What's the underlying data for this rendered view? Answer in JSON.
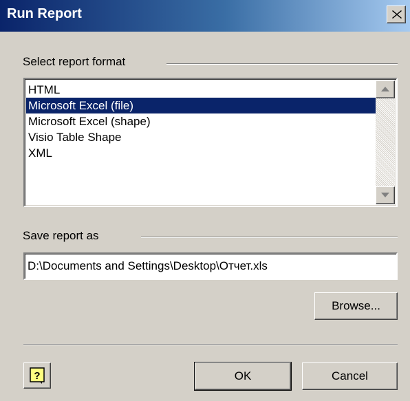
{
  "window": {
    "title": "Run Report"
  },
  "format_group": {
    "label": "Select report format",
    "items": [
      {
        "label": "HTML",
        "selected": false
      },
      {
        "label": "Microsoft Excel (file)",
        "selected": true
      },
      {
        "label": "Microsoft Excel (shape)",
        "selected": false
      },
      {
        "label": "Visio Table Shape",
        "selected": false
      },
      {
        "label": "XML",
        "selected": false
      }
    ]
  },
  "save_group": {
    "label": "Save report as",
    "path_value": "D:\\Documents and Settings\\Desktop\\Отчет.xls"
  },
  "buttons": {
    "browse_label": "Browse...",
    "ok_label": "OK",
    "cancel_label": "Cancel"
  },
  "colors": {
    "face": "#d4d0c8",
    "selection": "#0a246a",
    "titlebar_start": "#0a246a",
    "titlebar_end": "#a6caf0"
  },
  "icons": {
    "close": "close-icon",
    "scroll_up": "arrow-up-icon",
    "scroll_down": "arrow-down-icon",
    "help": "help-icon"
  }
}
